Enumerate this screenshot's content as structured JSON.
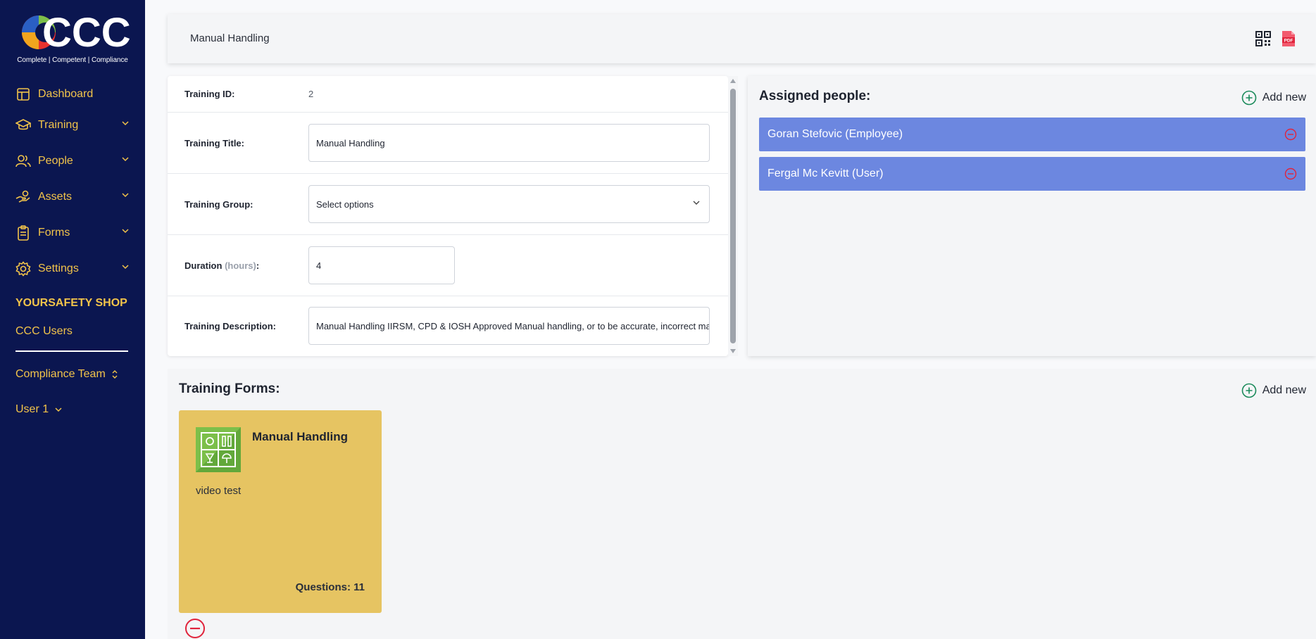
{
  "brand": {
    "logo_text": "CCC",
    "tagline": "Complete | Competent | Compliance"
  },
  "sidebar": {
    "items": [
      {
        "label": "Dashboard",
        "icon": "dashboard-icon"
      },
      {
        "label": "Training",
        "icon": "graduation-cap-icon"
      },
      {
        "label": "People",
        "icon": "people-icon"
      },
      {
        "label": "Assets",
        "icon": "hand-coins-icon"
      },
      {
        "label": "Forms",
        "icon": "clipboard-icon"
      },
      {
        "label": "Settings",
        "icon": "gear-icon"
      }
    ],
    "company": "YOURSAFETY SHOP",
    "users_link": "CCC Users",
    "team": "Compliance Team",
    "user": "User 1"
  },
  "header": {
    "title": "Manual Handling",
    "qr_icon": "qr-code-icon",
    "pdf_icon": "pdf-icon"
  },
  "details": {
    "id_label": "Training ID:",
    "id_value": "2",
    "title_label": "Training Title:",
    "title_value": "Manual Handling",
    "group_label": "Training Group:",
    "group_value": "Select options",
    "duration_label": "Duration",
    "duration_unit": "(hours)",
    "duration_colon": ":",
    "duration_value": "4",
    "description_label": "Training Description:",
    "description_value": "Manual Handling IIRSM, CPD & IOSH Approved Manual handling, or to be accurate, incorrect manual handling"
  },
  "assigned": {
    "title": "Assigned people:",
    "add_label": "Add new",
    "people": [
      {
        "name": "Goran Stefovic (Employee)"
      },
      {
        "name": "Fergal Mc Kevitt (User)"
      }
    ]
  },
  "forms": {
    "title": "Training Forms:",
    "add_label": "Add new",
    "cards": [
      {
        "title": "Manual Handling",
        "description": "video test",
        "questions": "Questions: 11"
      }
    ]
  },
  "colors": {
    "sidebar": "#0b1650",
    "accent": "#f2c44a",
    "person_bar": "#6c87e0",
    "card": "#e6c462",
    "danger": "#e0243c",
    "add": "#1a8a5a"
  }
}
